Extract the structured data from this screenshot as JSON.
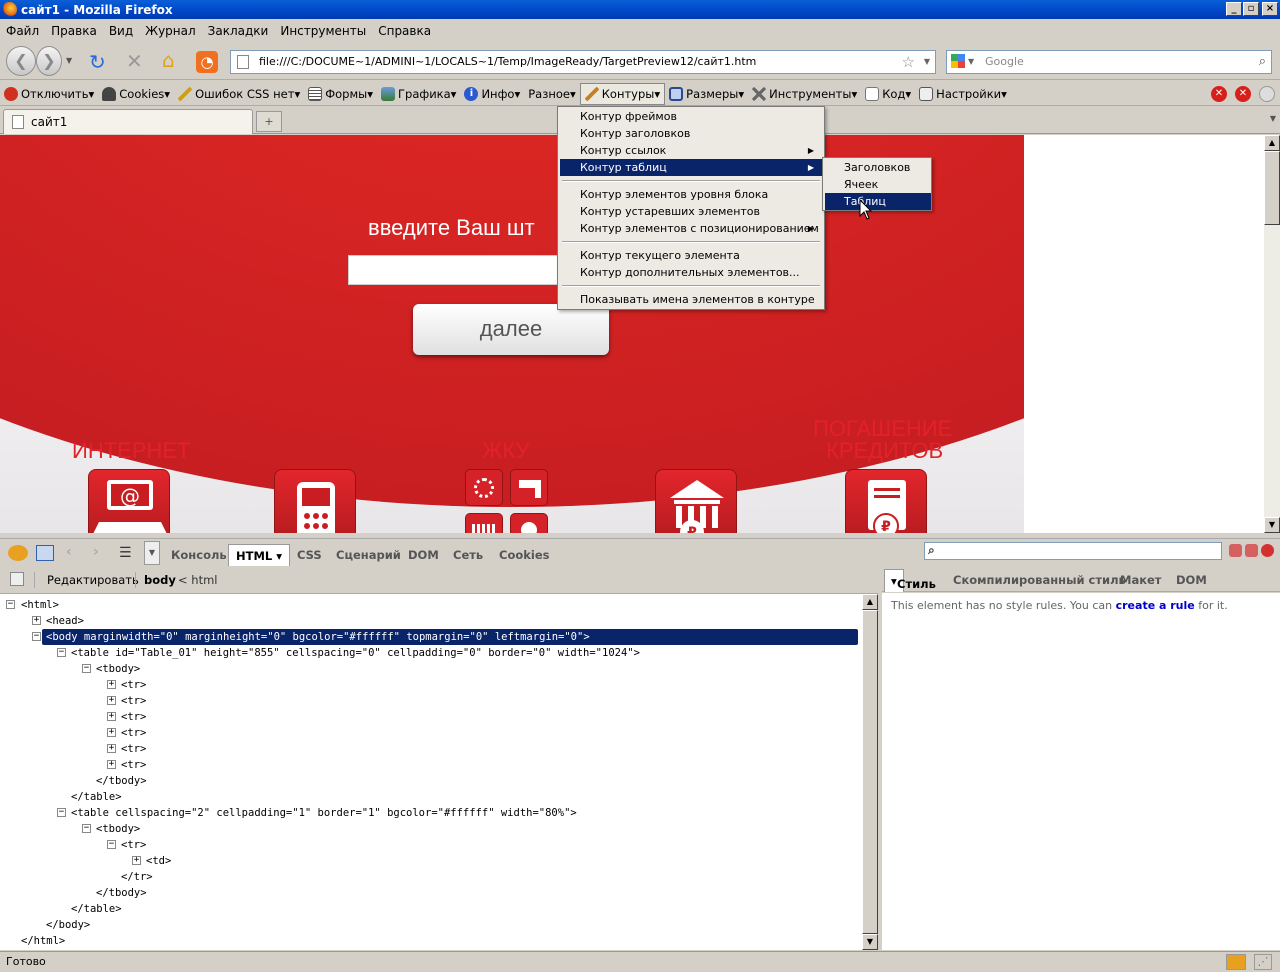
{
  "window": {
    "title": "сайт1 - Mozilla Firefox"
  },
  "menubar": [
    "Файл",
    "Правка",
    "Вид",
    "Журнал",
    "Закладки",
    "Инструменты",
    "Справка"
  ],
  "nav": {
    "url": "file:///C:/DOCUME~1/ADMINI~1/LOCALS~1/Temp/ImageReady/TargetPreview12/сайт1.htm",
    "search_placeholder": "Google"
  },
  "webdev": [
    "Отключить",
    "Cookies",
    "Ошибок CSS нет",
    "Формы",
    "Графика",
    "Инфо",
    "Разное",
    "Контуры",
    "Размеры",
    "Инструменты",
    "Код",
    "Настройки"
  ],
  "tab": {
    "title": "сайт1"
  },
  "site": {
    "headline": "введите Ваш шт",
    "next_button": "далее",
    "categories": [
      "ИНТЕРНЕТ",
      "ЖКУ",
      "ПОГАШЕНИЕ",
      "КРЕДИТОВ"
    ]
  },
  "dropdown": {
    "items": [
      "Контур фреймов",
      "Контур заголовков",
      "Контур ссылок",
      "Контур таблиц",
      "Контур элементов уровня блока",
      "Контур устаревших элементов",
      "Контур элементов с позиционированием",
      "Контур текущего элемента",
      "Контур дополнительных элементов...",
      "Показывать имена элементов в контуре"
    ],
    "submenu": [
      "Заголовков",
      "Ячеек",
      "Таблиц"
    ]
  },
  "firebug": {
    "tabs": [
      "Консоль",
      "HTML",
      "CSS",
      "Сценарий",
      "DOM",
      "Сеть",
      "Cookies"
    ],
    "edit_label": "Редактировать",
    "crumbs": [
      "body",
      "< html"
    ],
    "right_tabs": [
      "Стиль",
      "Скомпилированный стиль",
      "Макет",
      "DOM"
    ],
    "style_msg_pre": "This element has no style rules. You can ",
    "style_msg_link": "create a rule",
    "style_msg_post": " for it.",
    "tree": [
      "<html>",
      "<head>",
      "<body marginwidth=\"0\" marginheight=\"0\" bgcolor=\"#ffffff\" topmargin=\"0\" leftmargin=\"0\">",
      "<table id=\"Table_01\" height=\"855\" cellspacing=\"0\" cellpadding=\"0\" border=\"0\" width=\"1024\">",
      "<tbody>",
      "<tr>",
      "<tr>",
      "<tr>",
      "<tr>",
      "<tr>",
      "<tr>",
      "</tbody>",
      "</table>",
      "<table cellspacing=\"2\" cellpadding=\"1\" border=\"1\" bgcolor=\"#ffffff\" width=\"80%\">",
      "<tbody>",
      "<tr>",
      "<td>",
      "</tr>",
      "</tbody>",
      "</table>",
      "</body>",
      "</html>"
    ]
  },
  "status": {
    "text": "Готово"
  },
  "colors": {
    "brand_red": "#e3212a",
    "highlight": "#0a246a"
  }
}
